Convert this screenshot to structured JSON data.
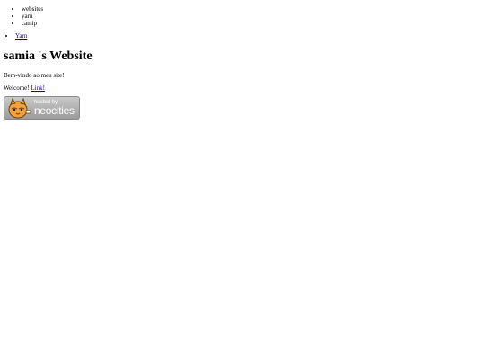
{
  "tags": [
    "websites",
    "yarn",
    "catnip"
  ],
  "nav": [
    {
      "label": "Yarn"
    }
  ],
  "page": {
    "title": "samia 's Website",
    "greeting": "Bem-vindo ao meu site!",
    "welcome_prefix": "Welcome!",
    "welcome_link": "Link!"
  },
  "badge": {
    "icon": "neocities-cat-icon",
    "hosted_text": "hosted by",
    "brand_text": "neocities"
  }
}
